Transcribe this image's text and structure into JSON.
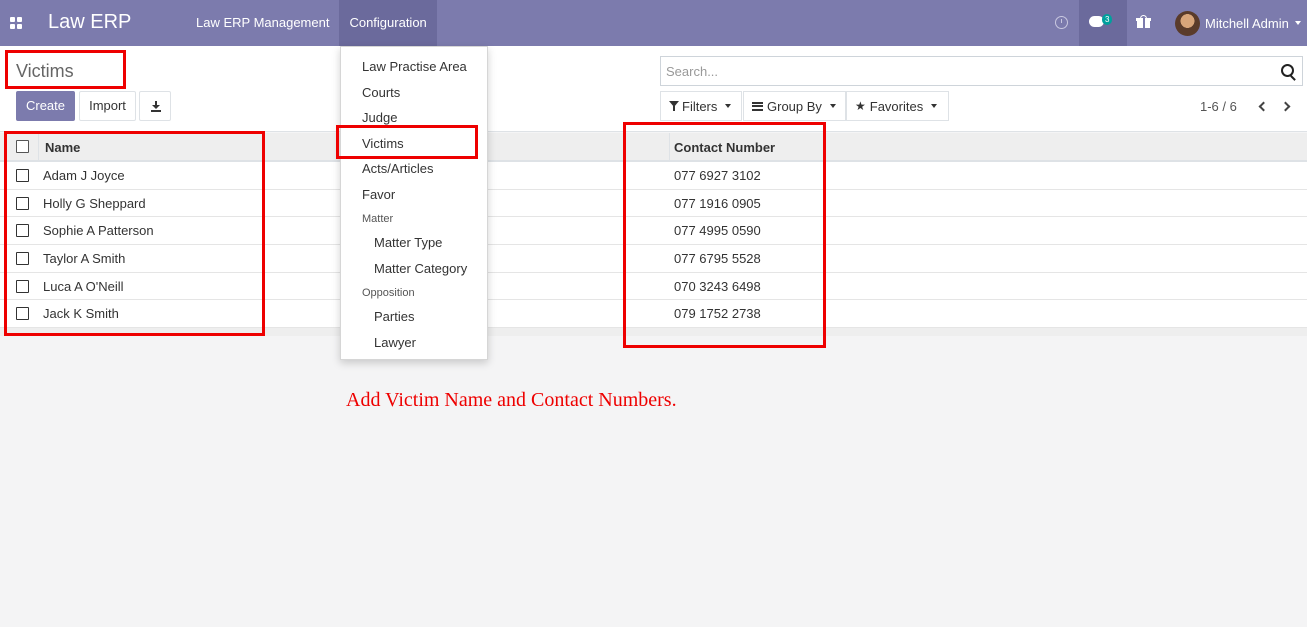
{
  "navbar": {
    "apps_icon": "apps-grid-icon",
    "brand": "Law ERP",
    "menu": [
      {
        "label": "Law ERP Management"
      },
      {
        "label": "Configuration"
      }
    ],
    "clock_icon": "clock-icon",
    "messages_badge": "3",
    "gift_icon": "gift-icon",
    "user_name": "Mitchell Admin"
  },
  "control": {
    "title": "Victims",
    "create_label": "Create",
    "import_label": "Import",
    "search_placeholder": "Search...",
    "filters_label": "Filters",
    "groupby_label": "Group By",
    "favorites_label": "Favorites",
    "pager": "1-6 / 6"
  },
  "table": {
    "columns": {
      "name": "Name",
      "contact": "Contact Number"
    },
    "rows": [
      {
        "name": "Adam J Joyce",
        "contact": "077 6927 3102"
      },
      {
        "name": "Holly G Sheppard",
        "contact": "077 1916 0905"
      },
      {
        "name": "Sophie A Patterson",
        "contact": "077 4995 0590"
      },
      {
        "name": "Taylor A Smith",
        "contact": "077 6795 5528"
      },
      {
        "name": "Luca A O'Neill",
        "contact": "070 3243 6498"
      },
      {
        "name": "Jack K Smith",
        "contact": "079 1752 2738"
      }
    ]
  },
  "dropdown": {
    "items": [
      "Law Practise Area",
      "Courts",
      "Judge",
      "Victims",
      "Acts/Articles",
      "Favor"
    ],
    "matter_header": "Matter",
    "matter_items": [
      "Matter Type",
      "Matter Category"
    ],
    "opposition_header": "Opposition",
    "opposition_items": [
      "Parties",
      "Lawyer"
    ]
  },
  "annotation": {
    "note": "Add Victim Name and Contact Numbers.",
    "color": "#ee0000"
  },
  "colors": {
    "navbar": "#7c7bad",
    "primary": "#7c7bad",
    "badge": "#00a09d"
  }
}
